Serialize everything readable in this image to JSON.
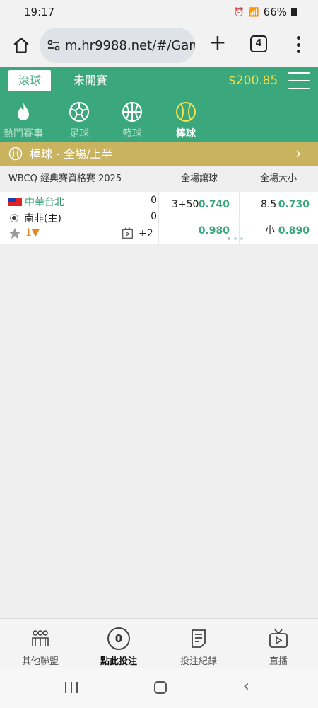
{
  "status_bar": {
    "time": "19:17",
    "battery": "66%"
  },
  "browser": {
    "url": "m.hr9988.net/#/Gam",
    "tab_count": "4"
  },
  "header": {
    "tab_live": "滾球",
    "tab_upcoming": "未開賽",
    "balance": "$200.85"
  },
  "sport_tabs": [
    {
      "label": "熱門賽事",
      "icon": "fire-icon",
      "active": false
    },
    {
      "label": "足球",
      "icon": "soccer-icon",
      "active": false
    },
    {
      "label": "籃球",
      "icon": "basketball-icon",
      "active": false
    },
    {
      "label": "棒球",
      "icon": "baseball-icon",
      "active": true
    }
  ],
  "section": {
    "title": "棒球 - 全場/上半"
  },
  "league": {
    "name": "WBCQ 經典賽資格賽 2025",
    "col_handicap": "全場讓球",
    "col_over_under": "全場大小"
  },
  "match": {
    "home_team": "中華台北",
    "away_team": "南非(主)",
    "home_score": "0",
    "away_score": "0",
    "rank": "1",
    "more_markets": "+2",
    "handicap_line": "3+50",
    "handicap_home": "0.740",
    "handicap_away": "0.980",
    "ou_line": "8.5",
    "ou_over": "0.730",
    "ou_under_label": "小",
    "ou_under": "0.890"
  },
  "bottom_nav": [
    {
      "label": "其他聯盟",
      "icon": "leagues-icon"
    },
    {
      "label": "點此投注",
      "icon": "bet-slip-icon",
      "count": "0"
    },
    {
      "label": "投注紀錄",
      "icon": "bet-history-icon"
    },
    {
      "label": "直播",
      "icon": "live-tv-icon"
    }
  ],
  "colors": {
    "brand_green": "#3aa77c",
    "section_gold": "#c9b35f",
    "balance_yellow": "#f6e04c",
    "odds_green": "#3aa77c"
  }
}
